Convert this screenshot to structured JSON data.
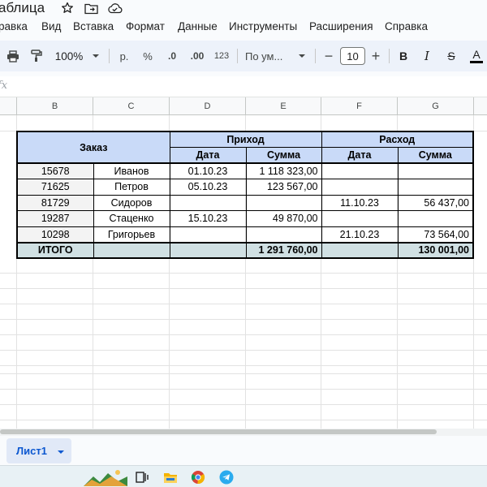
{
  "window": {
    "title": "аблица"
  },
  "menu": {
    "items": [
      "равка",
      "Вид",
      "Вставка",
      "Формат",
      "Данные",
      "Инструменты",
      "Расширения",
      "Справка"
    ]
  },
  "toolbar": {
    "zoom": "100%",
    "currency": "р.",
    "percent": "%",
    "decrease_decimals": ".0",
    "increase_decimals": ".00",
    "number_format": "123",
    "font_name": "По ум...",
    "font_size": "10",
    "bold": "B",
    "italic": "I",
    "strike": "S",
    "text_color": "A",
    "minus": "−",
    "plus": "+"
  },
  "formula_bar": {
    "fx": "fx",
    "value": ""
  },
  "columns": [
    "B",
    "C",
    "D",
    "E",
    "F",
    "G"
  ],
  "table": {
    "group_order": "Заказ",
    "group_income": "Приход",
    "group_expense": "Расход",
    "sub_date": "Дата",
    "sub_sum": "Сумма",
    "rows": [
      {
        "id": "15678",
        "name": "Иванов",
        "in_date": "01.10.23",
        "in_sum": "1 118 323,00",
        "out_date": "",
        "out_sum": ""
      },
      {
        "id": "71625",
        "name": "Петров",
        "in_date": "05.10.23",
        "in_sum": "123 567,00",
        "out_date": "",
        "out_sum": ""
      },
      {
        "id": "81729",
        "name": "Сидоров",
        "in_date": "",
        "in_sum": "",
        "out_date": "11.10.23",
        "out_sum": "56 437,00"
      },
      {
        "id": "19287",
        "name": "Стаценко",
        "in_date": "15.10.23",
        "in_sum": "49 870,00",
        "out_date": "",
        "out_sum": ""
      },
      {
        "id": "10298",
        "name": "Григорьев",
        "in_date": "",
        "in_sum": "",
        "out_date": "21.10.23",
        "out_sum": "73 564,00"
      }
    ],
    "total": {
      "label": "ИТОГО",
      "in_sum": "1 291 760,00",
      "out_sum": "130 001,00"
    }
  },
  "sheets": {
    "active": "Лист1"
  },
  "colors": {
    "header_fill": "#c9daf8",
    "total_fill": "#d0e0e3",
    "toolbar_bg": "#edf2fa",
    "tab_accent": "#0b57d0"
  }
}
